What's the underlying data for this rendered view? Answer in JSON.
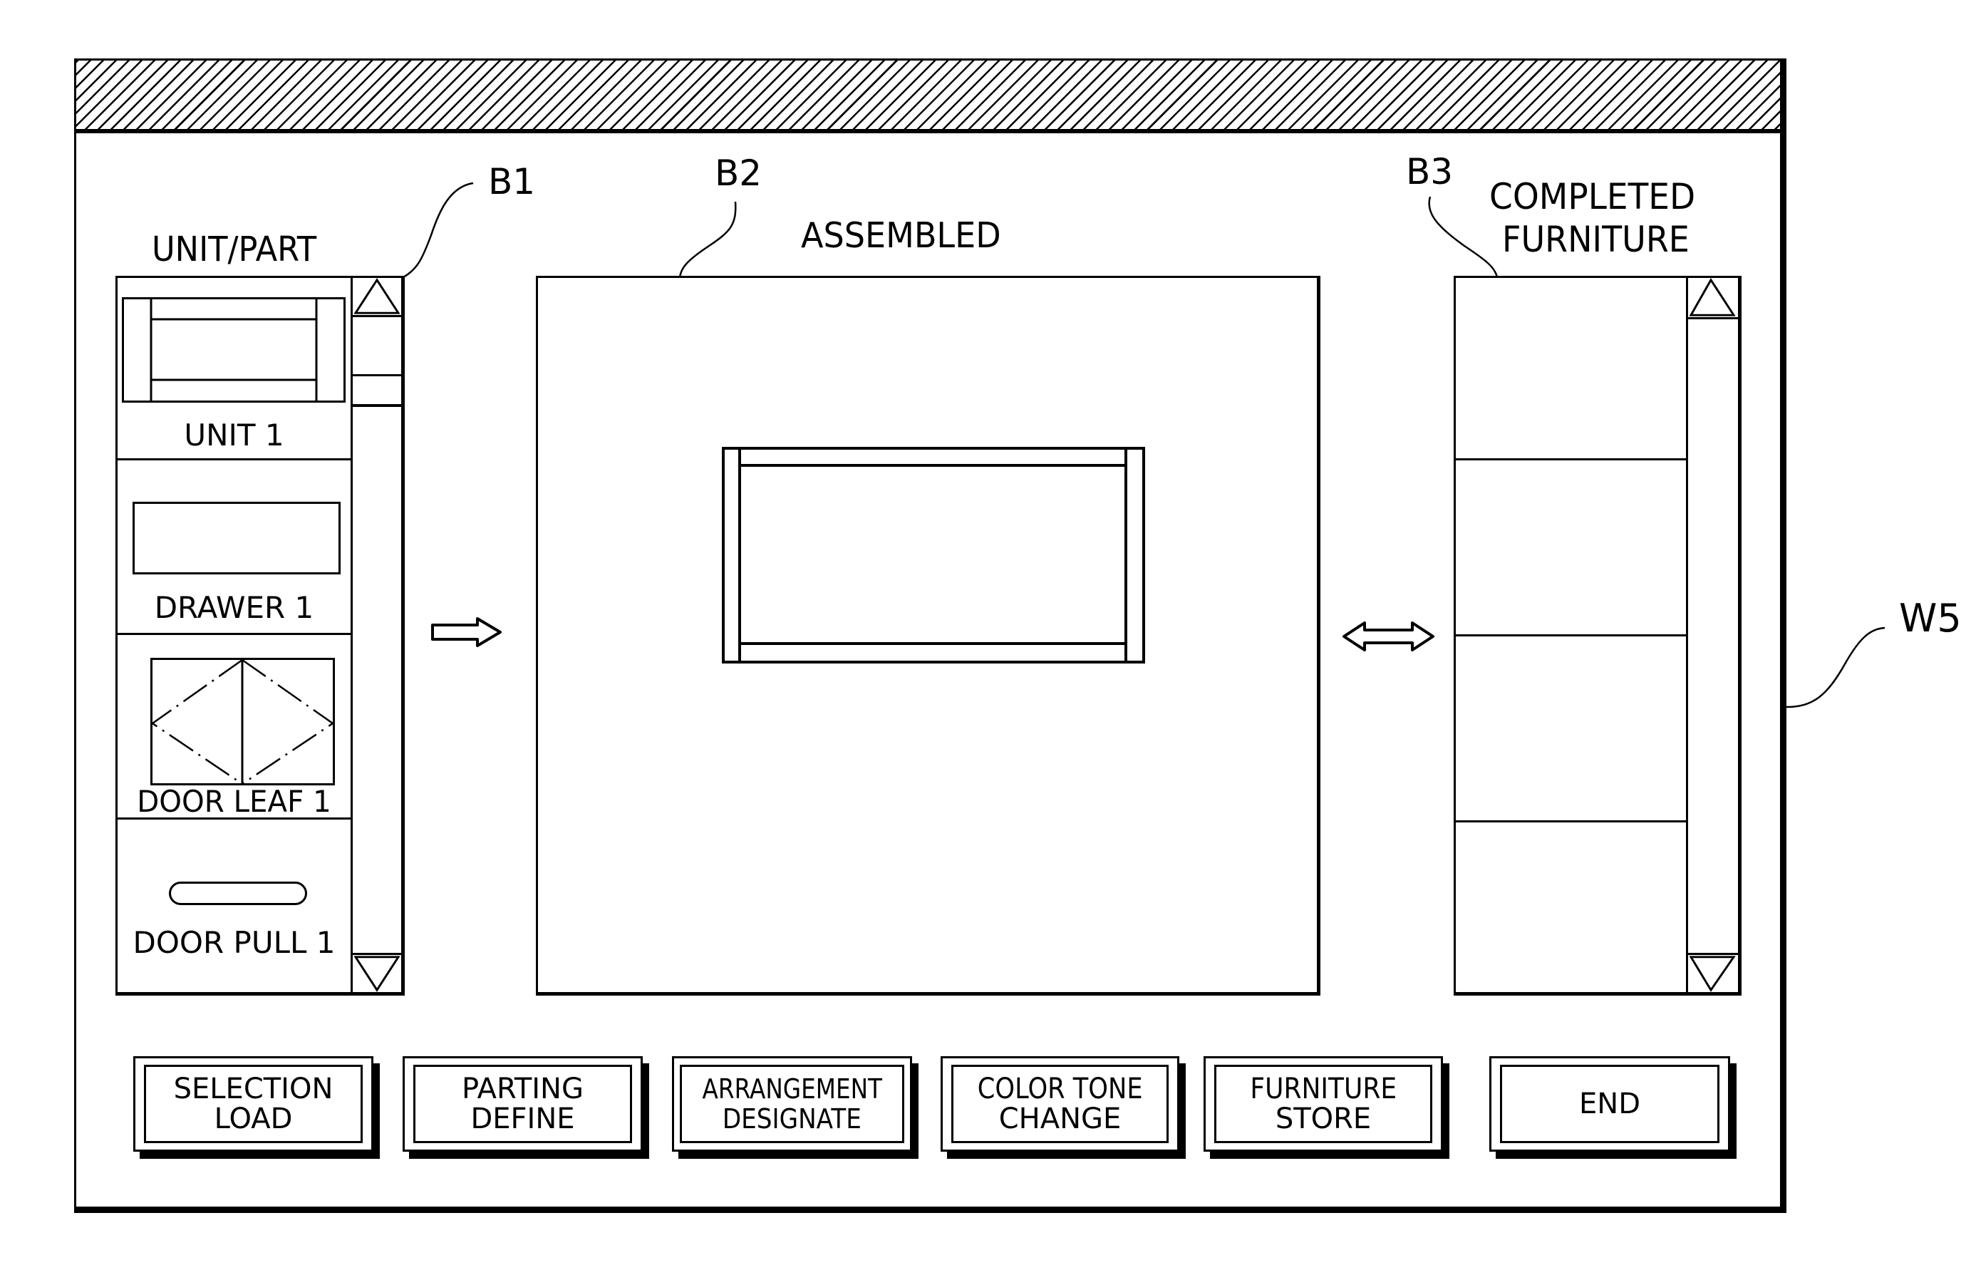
{
  "window": {
    "reference": "W5",
    "title": ""
  },
  "parts_panel": {
    "reference": "B1",
    "heading": "UNIT/PART",
    "items": [
      {
        "label": "UNIT 1",
        "icon": "cabinet-unit-icon"
      },
      {
        "label": "DRAWER 1",
        "icon": "drawer-icon"
      },
      {
        "label": "DOOR LEAF 1",
        "icon": "door-leaf-icon"
      },
      {
        "label": "DOOR PULL 1",
        "icon": "door-pull-icon"
      }
    ],
    "scroll_up_icon": "triangle-up-icon",
    "scroll_down_icon": "triangle-down-icon"
  },
  "add_arrow": {
    "icon": "arrow-right-icon"
  },
  "assembly_panel": {
    "reference": "B2",
    "heading": "ASSEMBLED",
    "content_icon": "assembled-cabinet-icon"
  },
  "transfer_arrow": {
    "icon": "arrow-left-right-icon"
  },
  "completed_panel": {
    "reference": "B3",
    "heading_line1": "COMPLETED",
    "heading_line2": "FURNITURE",
    "slots": [
      "",
      "",
      "",
      ""
    ],
    "scroll_up_icon": "triangle-up-icon",
    "scroll_down_icon": "triangle-down-icon"
  },
  "buttons": [
    {
      "id": "selection-load",
      "line1": "SELECTION",
      "line2": "LOAD"
    },
    {
      "id": "parting-define",
      "line1": "PARTING",
      "line2": "DEFINE"
    },
    {
      "id": "arrangement-designate",
      "line1": "ARRANGEMENT",
      "line2": "DESIGNATE"
    },
    {
      "id": "color-tone-change",
      "line1": "COLOR TONE",
      "line2": "CHANGE"
    },
    {
      "id": "furniture-store",
      "line1": "FURNITURE",
      "line2": "STORE"
    },
    {
      "id": "end",
      "line1": "END",
      "line2": ""
    }
  ],
  "colors": {
    "ink": "#000000",
    "paper": "#ffffff"
  }
}
